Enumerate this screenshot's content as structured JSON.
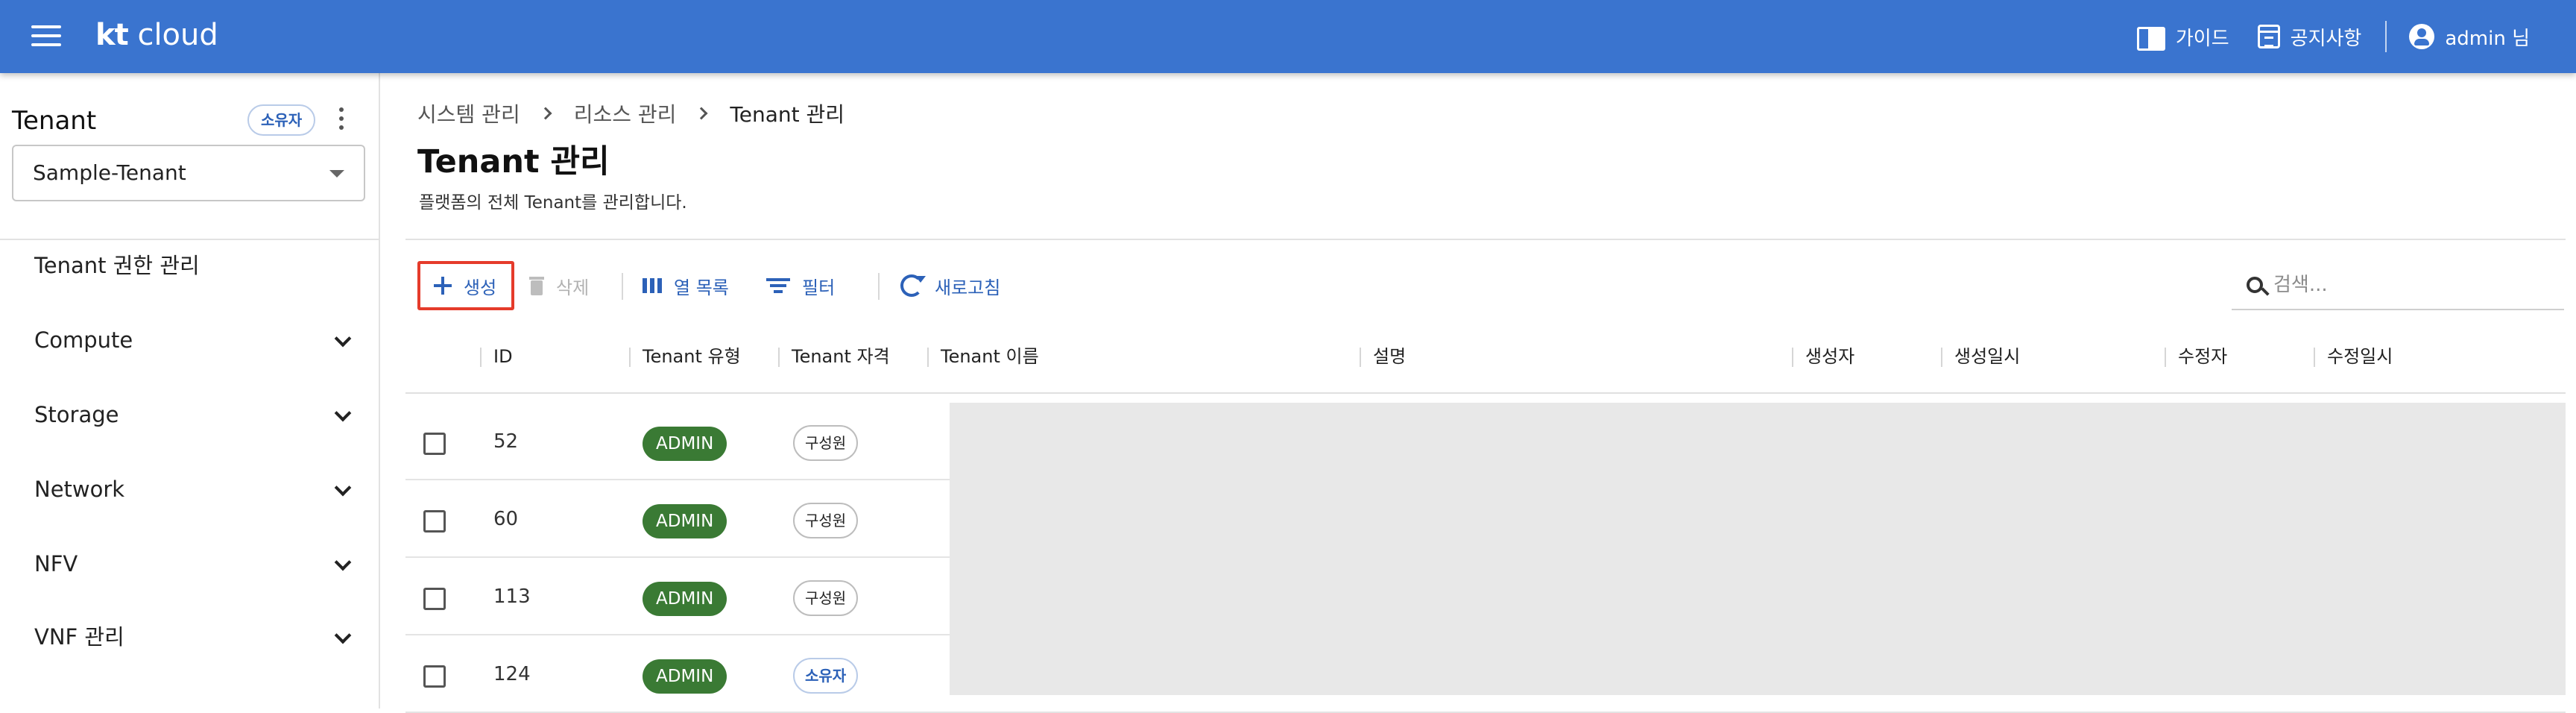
{
  "header": {
    "logo_bold": "kt",
    "logo_rest": " cloud",
    "guide": "가이드",
    "notice": "공지사항",
    "user": "admin 님"
  },
  "sidebar": {
    "title": "Tenant",
    "badge": "소유자",
    "selected_tenant": "Sample-Tenant",
    "items": [
      {
        "label": "Tenant 권한 관리",
        "expandable": false
      },
      {
        "label": "Compute",
        "expandable": true
      },
      {
        "label": "Storage",
        "expandable": true
      },
      {
        "label": "Network",
        "expandable": true
      },
      {
        "label": "NFV",
        "expandable": true
      },
      {
        "label": "VNF 관리",
        "expandable": true
      }
    ]
  },
  "main": {
    "breadcrumb": [
      "시스템 관리",
      "리소스 관리",
      "Tenant 관리"
    ],
    "title": "Tenant 관리",
    "description": "플랫폼의 전체 Tenant를 관리합니다.",
    "toolbar": {
      "create": "생성",
      "delete": "삭제",
      "columns": "열 목록",
      "filter": "필터",
      "refresh": "새로고침",
      "search_placeholder": "검색..."
    },
    "table": {
      "columns": [
        "ID",
        "Tenant 유형",
        "Tenant 자격",
        "Tenant 이름",
        "설명",
        "생성자",
        "생성일시",
        "수정자",
        "수정일시"
      ],
      "rows": [
        {
          "id": "52",
          "type": "ADMIN",
          "role": "구성원"
        },
        {
          "id": "60",
          "type": "ADMIN",
          "role": "구성원"
        },
        {
          "id": "113",
          "type": "ADMIN",
          "role": "구성원"
        },
        {
          "id": "124",
          "type": "ADMIN",
          "role": "소유자"
        }
      ]
    }
  },
  "colors": {
    "topbar": "#3a74cf",
    "accent": "#2c61b8",
    "admin_chip": "#3a7a34",
    "highlight_border": "#e53b2b",
    "redacted": "#e8e8e8"
  }
}
